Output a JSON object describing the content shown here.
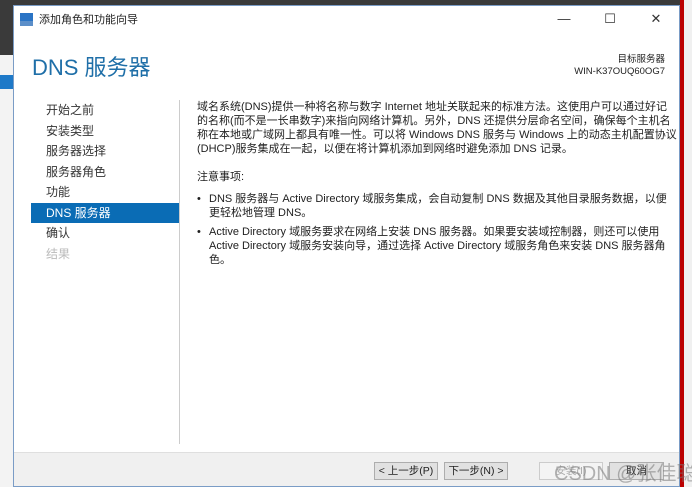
{
  "window": {
    "title": "添加角色和功能向导",
    "minimize": "—",
    "maximize": "☐",
    "close": "✕"
  },
  "header": {
    "title": "DNS 服务器",
    "target_label": "目标服务器",
    "target_name": "WIN-K37OUQ60OG7"
  },
  "nav": [
    {
      "label": "开始之前"
    },
    {
      "label": "安装类型"
    },
    {
      "label": "服务器选择"
    },
    {
      "label": "服务器角色"
    },
    {
      "label": "功能"
    },
    {
      "label": "DNS 服务器",
      "selected": true
    },
    {
      "label": "确认"
    },
    {
      "label": "结果",
      "disabled": true
    }
  ],
  "content": {
    "intro": "域名系统(DNS)提供一种将名称与数字 Internet 地址关联起来的标准方法。这使用户可以通过好记的名称(而不是一长串数字)来指向网络计算机。另外，DNS 还提供分层命名空间，确保每个主机名称在本地或广域网上都具有唯一性。可以将 Windows DNS 服务与 Windows 上的动态主机配置协议(DHCP)服务集成在一起，以便在将计算机添加到网络时避免添加 DNS 记录。",
    "notes_title": "注意事项:",
    "notes": [
      "DNS 服务器与 Active Directory 域服务集成，会自动复制 DNS 数据及其他目录服务数据，以便更轻松地管理 DNS。",
      "Active Directory 域服务要求在网络上安装 DNS 服务器。如果要安装域控制器，则还可以使用 Active Directory 域服务安装向导，通过选择 Active Directory 域服务角色来安装 DNS 服务器角色。"
    ]
  },
  "footer": {
    "prev": "< 上一步(P)",
    "next": "下一步(N) >",
    "install": "安装(I)",
    "cancel": "取消"
  },
  "watermark": "CSDN @张佳聪"
}
